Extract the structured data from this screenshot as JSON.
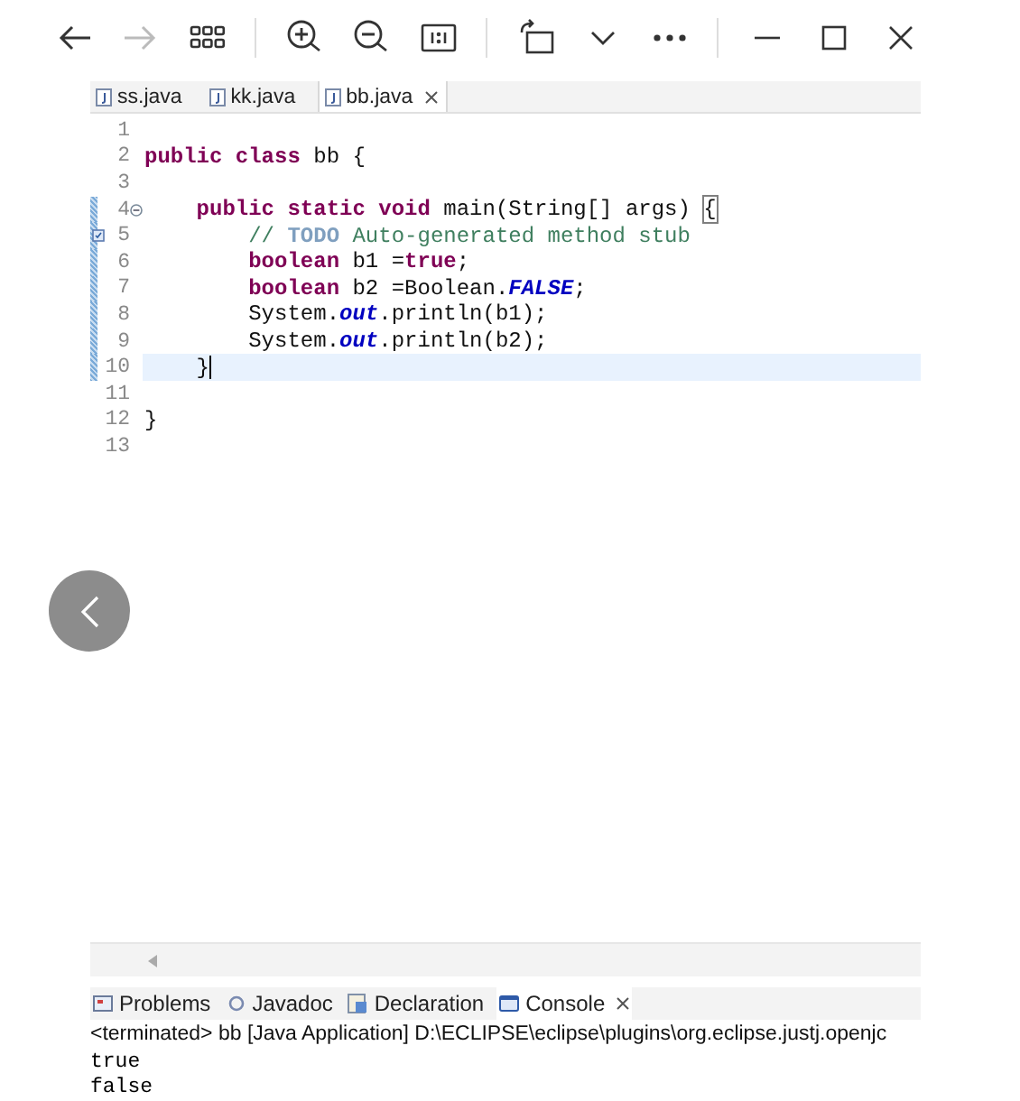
{
  "toolbar": [
    {
      "kind": "back",
      "disabled": false
    },
    {
      "kind": "forward",
      "disabled": true
    },
    {
      "kind": "grid",
      "disabled": false
    },
    {
      "kind": "separator"
    },
    {
      "kind": "zoom-in",
      "disabled": false
    },
    {
      "kind": "zoom-out",
      "disabled": false
    },
    {
      "kind": "actual-size",
      "disabled": false
    },
    {
      "kind": "separator"
    },
    {
      "kind": "rotate",
      "disabled": false
    },
    {
      "kind": "chevron",
      "disabled": false
    },
    {
      "kind": "more",
      "disabled": false
    },
    {
      "kind": "separator"
    },
    {
      "kind": "minimize",
      "disabled": false
    },
    {
      "kind": "maximize",
      "disabled": false
    },
    {
      "kind": "close",
      "disabled": false
    }
  ],
  "editor": {
    "tabs": [
      {
        "label": "ss.java",
        "selected": false
      },
      {
        "label": "kk.java",
        "selected": false
      },
      {
        "label": "bb.java",
        "selected": true
      }
    ],
    "lines": [
      {
        "number": "1",
        "marked": false,
        "foldable": false,
        "task": false,
        "current": false
      },
      {
        "number": "2",
        "marked": false,
        "foldable": false,
        "task": false,
        "current": false,
        "tokens": [
          {
            "kind": "keyword",
            "text": "public class"
          },
          {
            "kind": "plain",
            "text": " bb {"
          }
        ]
      },
      {
        "number": "3",
        "marked": false,
        "foldable": false,
        "task": false,
        "current": false
      },
      {
        "number": "4",
        "marked": true,
        "foldable": true,
        "task": false,
        "current": false,
        "tokens": [
          {
            "kind": "keyword",
            "text": "    public static void"
          },
          {
            "kind": "plain",
            "text": " main(String[] args) "
          },
          {
            "kind": "matched-bracket",
            "text": "{"
          }
        ]
      },
      {
        "number": "5",
        "marked": true,
        "foldable": false,
        "task": true,
        "current": false,
        "tokens": [
          {
            "kind": "comment",
            "text": "        // "
          },
          {
            "kind": "todo",
            "text": "TODO"
          },
          {
            "kind": "comment",
            "text": " Auto-generated method stub"
          }
        ]
      },
      {
        "number": "6",
        "marked": true,
        "foldable": false,
        "task": false,
        "current": false,
        "tokens": [
          {
            "kind": "keyword",
            "text": "        boolean"
          },
          {
            "kind": "plain",
            "text": " b1 ="
          },
          {
            "kind": "keyword",
            "text": "true"
          },
          {
            "kind": "plain",
            "text": ";"
          }
        ]
      },
      {
        "number": "7",
        "marked": true,
        "foldable": false,
        "task": false,
        "current": false,
        "tokens": [
          {
            "kind": "keyword",
            "text": "        boolean"
          },
          {
            "kind": "plain",
            "text": " b2 =Boolean."
          },
          {
            "kind": "constant",
            "text": "FALSE"
          },
          {
            "kind": "plain",
            "text": ";"
          }
        ]
      },
      {
        "number": "8",
        "marked": true,
        "foldable": false,
        "task": false,
        "current": false,
        "tokens": [
          {
            "kind": "plain",
            "text": "        System."
          },
          {
            "kind": "field",
            "text": "out"
          },
          {
            "kind": "plain",
            "text": ".println(b1);"
          }
        ]
      },
      {
        "number": "9",
        "marked": true,
        "foldable": false,
        "task": false,
        "current": false,
        "tokens": [
          {
            "kind": "plain",
            "text": "        System."
          },
          {
            "kind": "field",
            "text": "out"
          },
          {
            "kind": "plain",
            "text": ".println(b2);"
          }
        ]
      },
      {
        "number": "10",
        "marked": true,
        "foldable": false,
        "task": false,
        "current": true,
        "tokens": [
          {
            "kind": "plain",
            "text": "    }"
          }
        ]
      },
      {
        "number": "11",
        "marked": false,
        "foldable": false,
        "task": false,
        "current": false
      },
      {
        "number": "12",
        "marked": false,
        "foldable": false,
        "task": false,
        "current": false,
        "tokens": [
          {
            "kind": "plain",
            "text": "}"
          }
        ]
      },
      {
        "number": "13",
        "marked": false,
        "foldable": false,
        "task": false,
        "current": false
      }
    ]
  },
  "panel": {
    "tabs": [
      {
        "label": "Problems",
        "kind": "problems",
        "selected": false
      },
      {
        "label": "Javadoc",
        "kind": "javadoc",
        "selected": false
      },
      {
        "label": "Declaration",
        "kind": "declaration",
        "selected": false
      },
      {
        "label": "Console",
        "kind": "console",
        "selected": true
      }
    ],
    "header": "<terminated> bb [Java Application] D:\\ECLIPSE\\eclipse\\plugins\\org.eclipse.justj.openjc",
    "output": [
      "true",
      "false"
    ]
  }
}
